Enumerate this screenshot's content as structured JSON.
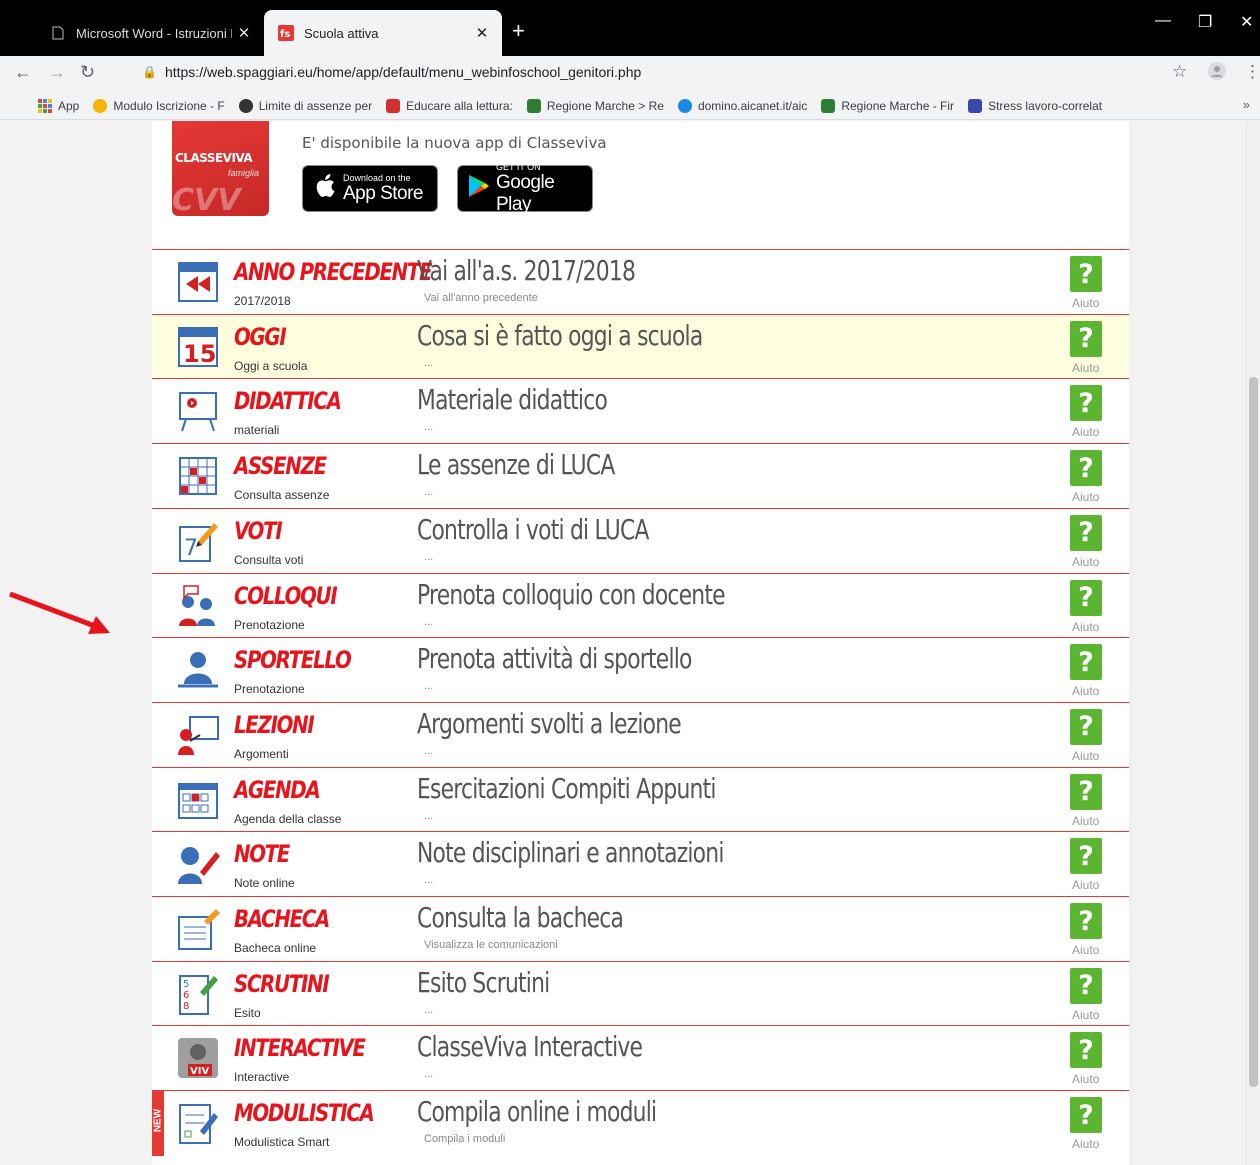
{
  "browser": {
    "tabs": [
      {
        "title": "Microsoft Word - Istruzioni Prenc",
        "active": false
      },
      {
        "title": "Scuola attiva",
        "active": true
      }
    ],
    "new_tab_label": "+",
    "url": "https://web.spaggiari.eu/home/app/default/menu_webinfoschool_genitori.php",
    "bookmarks": [
      {
        "label": "App",
        "color": "#4285f4"
      },
      {
        "label": "Modulo Iscrizione - F",
        "color": "#f4b400"
      },
      {
        "label": "Limite di assenze per",
        "color": "#333333"
      },
      {
        "label": "Educare alla lettura: ",
        "color": "#d32f2f"
      },
      {
        "label": "Regione Marche > Re",
        "color": "#2e7d32"
      },
      {
        "label": "domino.aicanet.it/aic",
        "color": "#1e88e5"
      },
      {
        "label": "Regione Marche - Fir",
        "color": "#2e7d32"
      },
      {
        "label": "Stress lavoro-correlat",
        "color": "#3949ab"
      }
    ],
    "bookmarks_more": "»"
  },
  "promo": {
    "logo_text": "CLASSEVIVA",
    "logo_sub": "famiglia",
    "text": "E' disponibile la nuova app di Classeviva",
    "appstore_small": "Download on the",
    "appstore_big": "App Store",
    "googleplay_small": "GET IT ON",
    "googleplay_big": "Google Play"
  },
  "help_label": "Aiuto",
  "menu": [
    {
      "title": "ANNO PRECEDENTE",
      "sub": "2017/2018",
      "desc": "Vai all'a.s. 2017/2018",
      "detail": "Vai all'anno precedente",
      "icon": "calendar-rewind-icon",
      "highlight": false
    },
    {
      "title": "OGGI",
      "sub": "Oggi a scuola",
      "desc": "Cosa si è fatto oggi a scuola",
      "detail": "...",
      "icon": "calendar-15-icon",
      "highlight": true
    },
    {
      "title": "DIDATTICA",
      "sub": "materiali",
      "desc": "Materiale didattico",
      "detail": "...",
      "icon": "whiteboard-icon",
      "highlight": false
    },
    {
      "title": "ASSENZE",
      "sub": "Consulta assenze",
      "desc": "Le assenze di LUCA",
      "detail": "...",
      "icon": "absence-grid-icon",
      "highlight": false
    },
    {
      "title": "VOTI",
      "sub": "Consulta voti",
      "desc": "Controlla i voti di LUCA",
      "detail": "...",
      "icon": "grades-pencil-icon",
      "highlight": false
    },
    {
      "title": "COLLOQUI",
      "sub": "Prenotazione",
      "desc": "Prenota colloquio con docente",
      "detail": "...",
      "icon": "conversation-icon",
      "highlight": false
    },
    {
      "title": "SPORTELLO",
      "sub": "Prenotazione",
      "desc": "Prenota attività di sportello",
      "detail": "...",
      "icon": "desk-person-icon",
      "highlight": false
    },
    {
      "title": "LEZIONI",
      "sub": "Argomenti",
      "desc": "Argomenti svolti a lezione",
      "detail": "...",
      "icon": "teacher-board-icon",
      "highlight": false
    },
    {
      "title": "AGENDA",
      "sub": "Agenda della classe",
      "desc": "Esercitazioni Compiti Appunti",
      "detail": "...",
      "icon": "agenda-calendar-icon",
      "highlight": false
    },
    {
      "title": "NOTE",
      "sub": "Note online",
      "desc": "Note disciplinari e annotazioni",
      "detail": "...",
      "icon": "note-writing-icon",
      "highlight": false
    },
    {
      "title": "BACHECA",
      "sub": "Bacheca online",
      "desc": "Consulta la bacheca",
      "detail": "Visualizza le comunicazioni",
      "icon": "noticeboard-icon",
      "highlight": false
    },
    {
      "title": "SCRUTINI",
      "sub": "Esito",
      "desc": "Esito Scrutini",
      "detail": "...",
      "icon": "report-card-icon",
      "highlight": false
    },
    {
      "title": "INTERACTIVE",
      "sub": "Interactive",
      "desc": "ClasseViva Interactive",
      "detail": "...",
      "icon": "interactive-viv-icon",
      "highlight": false
    },
    {
      "title": "MODULISTICA",
      "sub": "Modulistica Smart",
      "desc": "Compila online i moduli",
      "detail": "Compila i moduli",
      "icon": "forms-icon",
      "highlight": false,
      "badge": "NEW"
    }
  ],
  "colors": {
    "accent_red": "#e8131b",
    "help_green": "#5cb531",
    "highlight_row": "#ffffdf"
  }
}
